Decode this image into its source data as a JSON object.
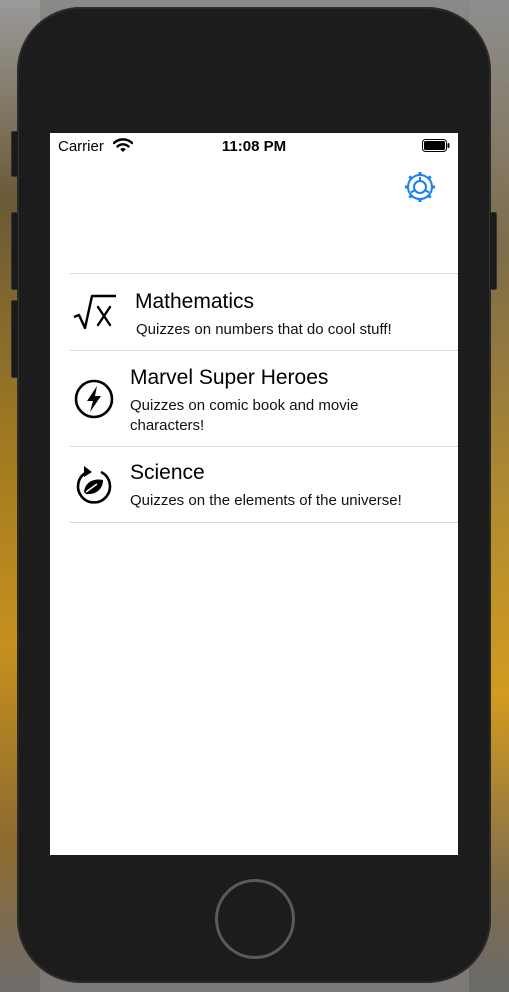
{
  "status_bar": {
    "carrier": "Carrier",
    "time": "11:08 PM"
  },
  "nav": {
    "settings_icon": "gear-icon",
    "accent_color": "#1a7ff0"
  },
  "topics": [
    {
      "title": "Mathematics",
      "description": "Quizzes on numbers that do cool stuff!",
      "icon": "square-root-icon"
    },
    {
      "title": "Marvel Super Heroes",
      "description": "Quizzes on comic book and movie characters!",
      "icon": "lightning-bolt-icon"
    },
    {
      "title": "Science",
      "description": "Quizzes on the elements of the universe!",
      "icon": "leaf-cycle-icon"
    }
  ]
}
